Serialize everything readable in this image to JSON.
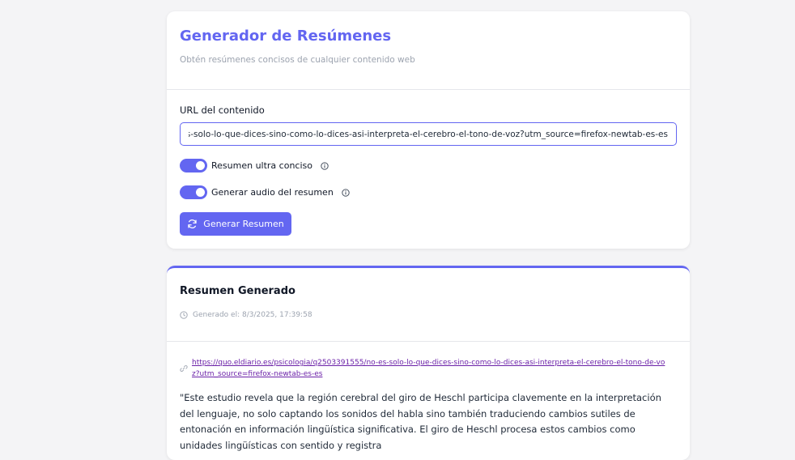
{
  "header": {
    "title": "Generador de Resúmenes",
    "subtitle": "Obtén resúmenes concisos de cualquier contenido web"
  },
  "form": {
    "url_label": "URL del contenido",
    "url_value": "https://quo.eldiario.es/psicologia/q2503391555/no-es-solo-lo-que-dices-sino-como-lo-dices-asi-interpreta-el-cerebro-el-tono-de-voz?utm_source=firefox-newtab-es-es",
    "toggle_concise": {
      "label": "Resumen ultra conciso",
      "enabled": true
    },
    "toggle_audio": {
      "label": "Generar audio del resumen",
      "enabled": true
    },
    "generate_button": "Generar Resumen"
  },
  "result": {
    "title": "Resumen Generado",
    "timestamp": "Generado el: 8/3/2025, 17:39:58",
    "source_url": "https://quo.eldiario.es/psicologia/q2503391555/no-es-solo-lo-que-dices-sino-como-lo-dices-asi-interpreta-el-cerebro-el-tono-de-voz?utm_source=firefox-newtab-es-es",
    "summary": "\"Este estudio revela que la región cerebral del giro de Heschl participa clavemente en la interpretación del lenguaje, no solo captando los sonidos del habla sino también traduciendo cambios sutiles de entonación en información lingüística significativa. El giro de Heschl procesa estos cambios como unidades lingüísticas con sentido y registra"
  },
  "colors": {
    "accent": "#6366f1",
    "background": "#f4f4f6",
    "link": "#6b21a8"
  },
  "icons": {
    "refresh": "refresh-icon",
    "info": "info-icon",
    "clock": "clock-icon",
    "link": "link-icon"
  }
}
